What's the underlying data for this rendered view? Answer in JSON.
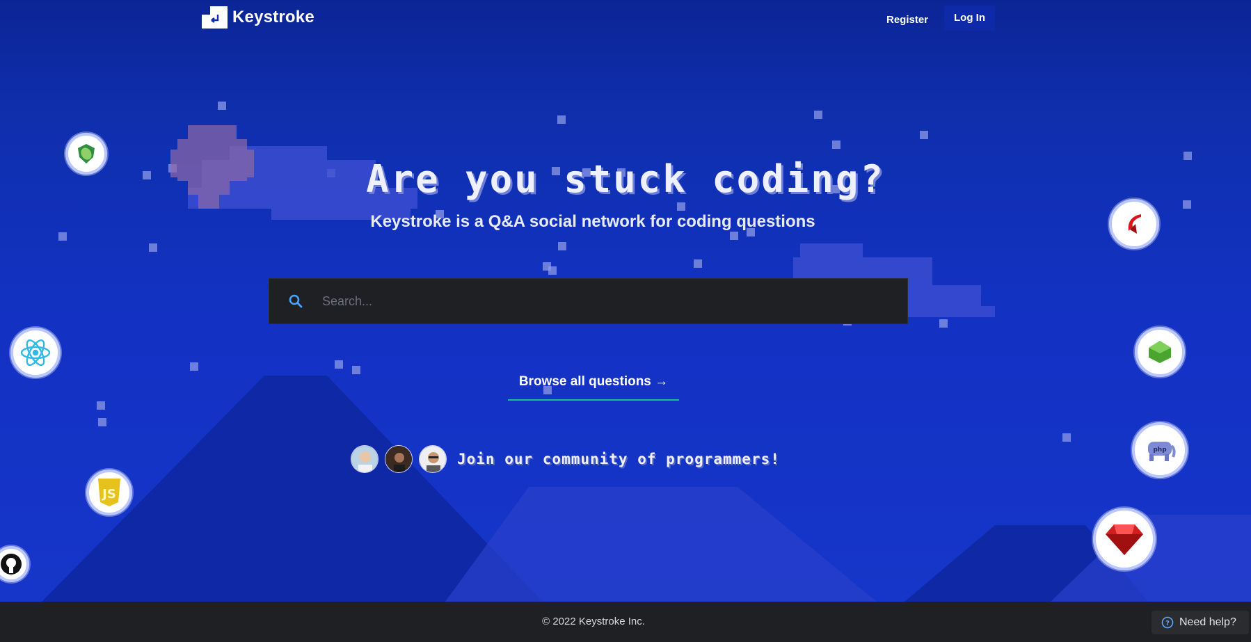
{
  "header": {
    "brand": "Keystroke",
    "register_label": "Register",
    "login_label": "Log In"
  },
  "hero": {
    "headline": "Are you stuck coding?",
    "subheadline": "Keystroke is a Q&A social network for coding questions"
  },
  "search": {
    "placeholder": "Search...",
    "value": "",
    "icon": "search-icon"
  },
  "browse": {
    "label": "Browse all questions →"
  },
  "community": {
    "label": "Join our community of programmers!",
    "avatars": [
      "avatar-1",
      "avatar-2",
      "avatar-3"
    ]
  },
  "tech_icons": [
    "vue-shield-icon",
    "react-icon",
    "javascript-icon",
    "github-icon",
    "scala-icon",
    "ruby-icon",
    "php-elephant-icon",
    "gem-icon",
    "green-cube-icon"
  ],
  "footer": {
    "copyright": "© 2022 Keystroke Inc.",
    "help_label": "Need help?"
  },
  "colors": {
    "background": "#1332c4",
    "footer": "#1f2023",
    "accent": "#1dbf8a",
    "search_bg": "#1f2023"
  }
}
